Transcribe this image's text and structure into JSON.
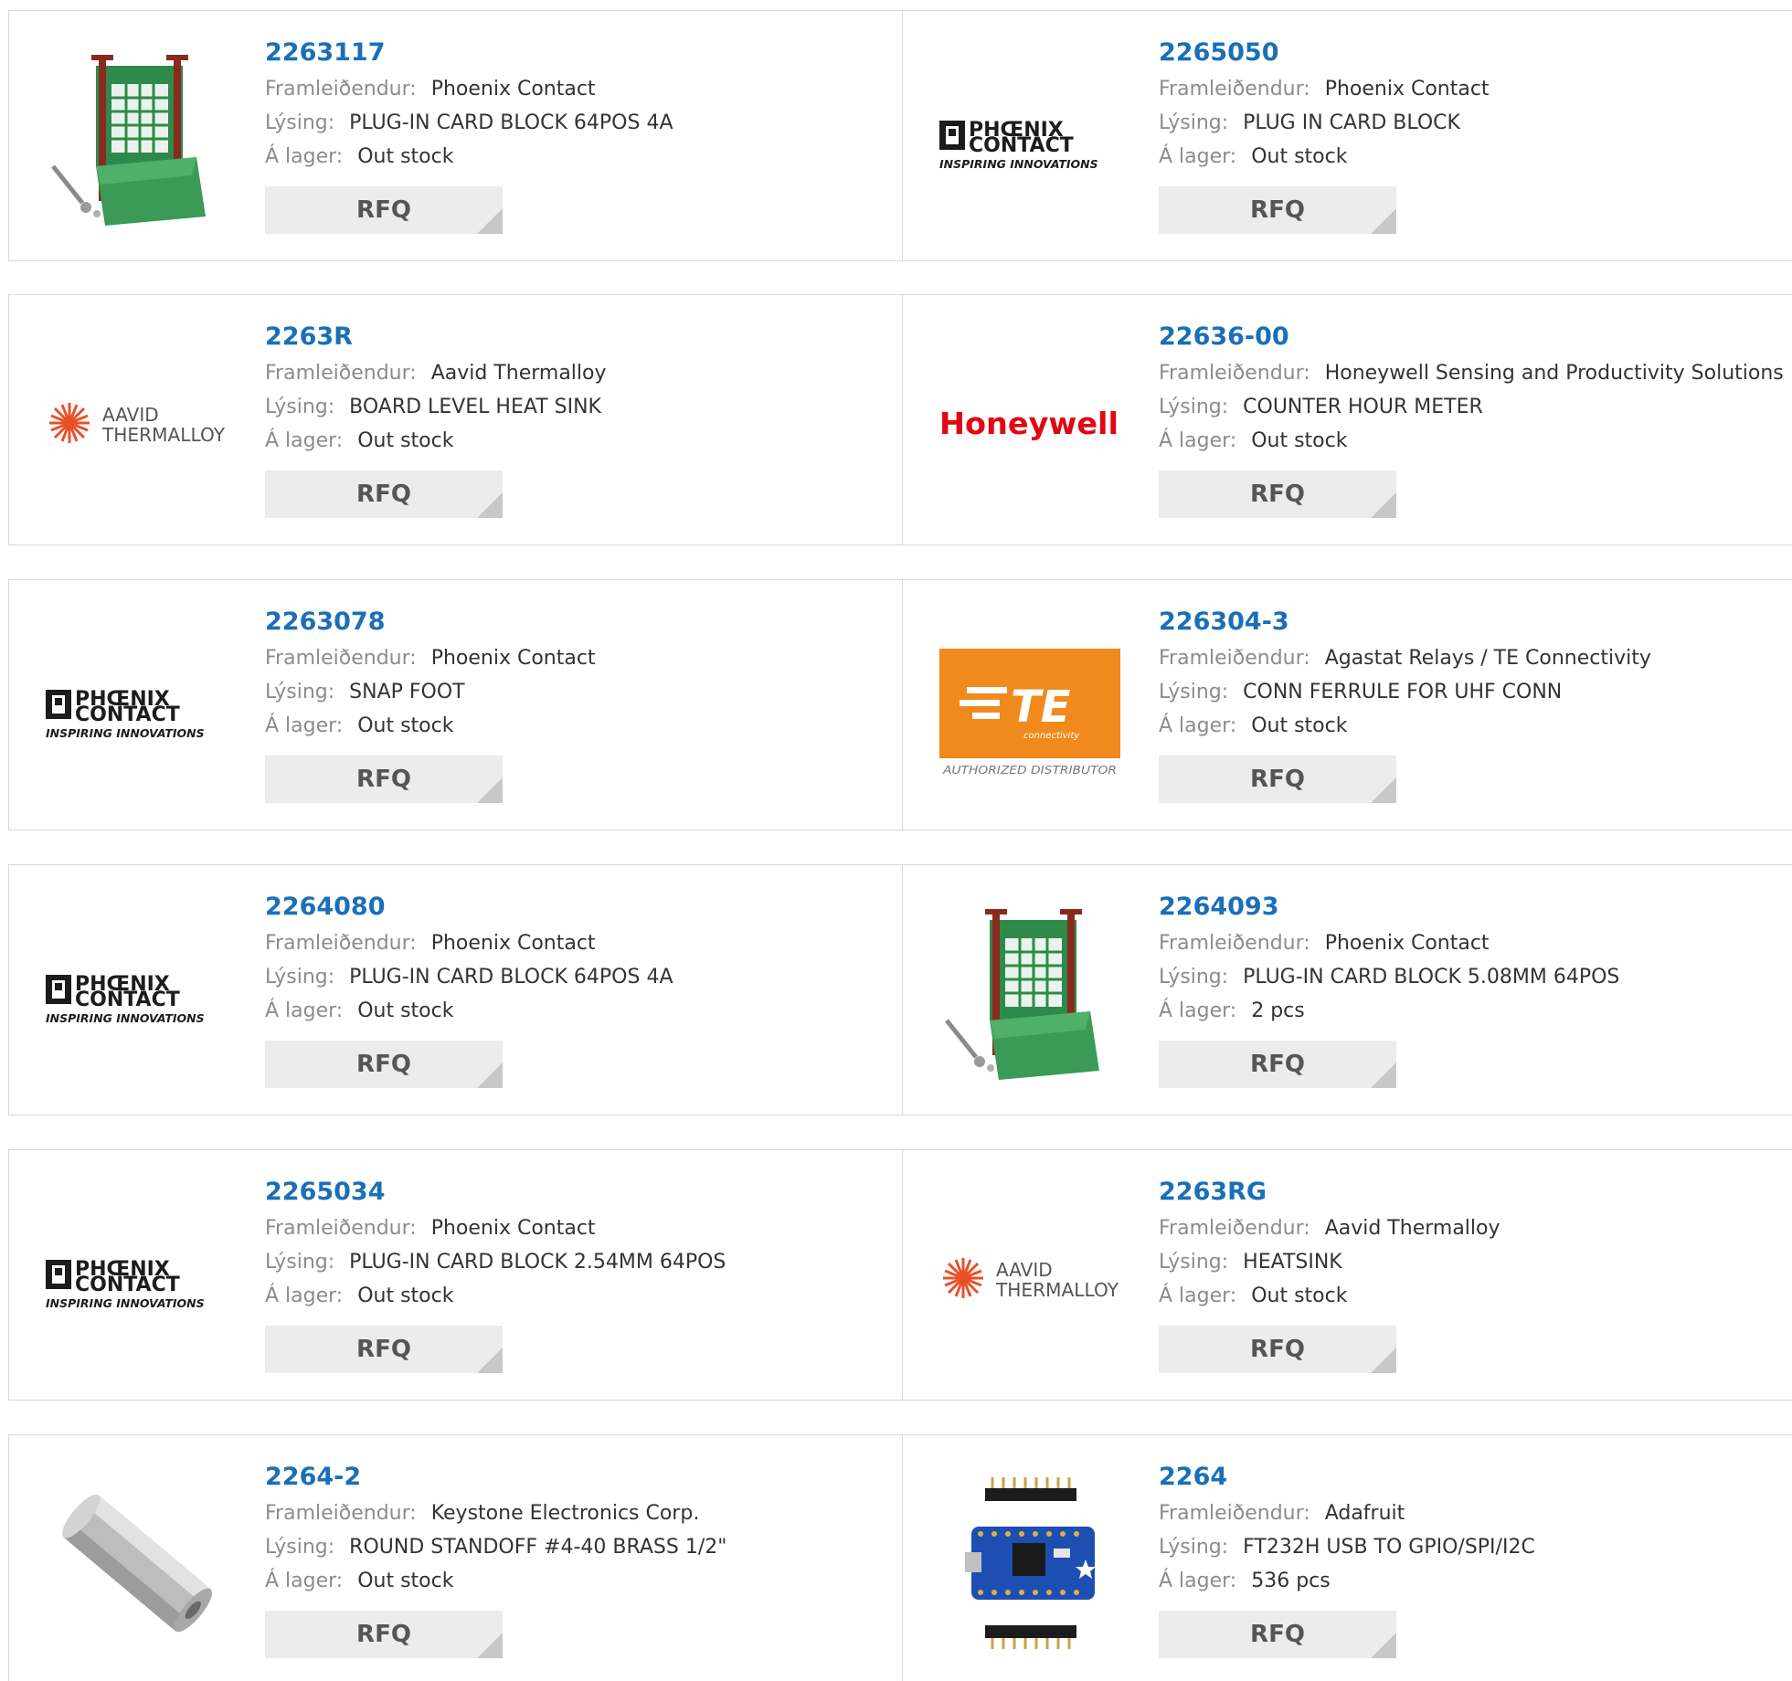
{
  "labels": {
    "manufacturer": "Framleiðendur:",
    "description": "Lýsing:",
    "stock": "Á lager:",
    "rfq": "RFQ"
  },
  "colors": {
    "part_link": "#1a6fb8",
    "label": "#8c8c8c",
    "button_bg": "#ececec"
  },
  "logos": {
    "phoenix_line1": "PHŒNIX",
    "phoenix_line2": "CONTACT",
    "phoenix_tag": "INSPIRING INNOVATIONS",
    "aavid_line1": "AAVID",
    "aavid_line2": "THERMALLOY",
    "honeywell": "Honeywell",
    "te_mark": "TE",
    "te_sub": "connectivity",
    "te_tag": "AUTHORIZED DISTRIBUTOR"
  },
  "products": [
    {
      "part": "2263117",
      "manufacturer": "Phoenix Contact",
      "description": "PLUG-IN CARD BLOCK 64POS 4A",
      "stock": "Out stock",
      "image": "card-block-photo"
    },
    {
      "part": "2265050",
      "manufacturer": "Phoenix Contact",
      "description": "PLUG IN CARD BLOCK",
      "stock": "Out stock",
      "image": "phoenix-contact-logo"
    },
    {
      "part": "2263R",
      "manufacturer": "Aavid Thermalloy",
      "description": "BOARD LEVEL HEAT SINK",
      "stock": "Out stock",
      "image": "aavid-thermalloy-logo"
    },
    {
      "part": "22636-00",
      "manufacturer": "Honeywell Sensing and Productivity Solutions",
      "description": "COUNTER HOUR METER",
      "stock": "Out stock",
      "image": "honeywell-logo"
    },
    {
      "part": "2263078",
      "manufacturer": "Phoenix Contact",
      "description": "SNAP FOOT",
      "stock": "Out stock",
      "image": "phoenix-contact-logo"
    },
    {
      "part": "226304-3",
      "manufacturer": "Agastat Relays / TE Connectivity",
      "description": "CONN FERRULE FOR UHF CONN",
      "stock": "Out stock",
      "image": "te-connectivity-logo"
    },
    {
      "part": "2264080",
      "manufacturer": "Phoenix Contact",
      "description": "PLUG-IN CARD BLOCK 64POS 4A",
      "stock": "Out stock",
      "image": "phoenix-contact-logo"
    },
    {
      "part": "2264093",
      "manufacturer": "Phoenix Contact",
      "description": "PLUG-IN CARD BLOCK 5.08MM 64POS",
      "stock": "2 pcs",
      "image": "card-block-photo"
    },
    {
      "part": "2265034",
      "manufacturer": "Phoenix Contact",
      "description": "PLUG-IN CARD BLOCK 2.54MM 64POS",
      "stock": "Out stock",
      "image": "phoenix-contact-logo"
    },
    {
      "part": "2263RG",
      "manufacturer": "Aavid Thermalloy",
      "description": "HEATSINK",
      "stock": "Out stock",
      "image": "aavid-thermalloy-logo"
    },
    {
      "part": "2264-2",
      "manufacturer": "Keystone Electronics Corp.",
      "description": "ROUND STANDOFF #4-40 BRASS 1/2\"",
      "stock": "Out stock",
      "image": "standoff-photo"
    },
    {
      "part": "2264",
      "manufacturer": "Adafruit",
      "description": "FT232H USB TO GPIO/SPI/I2C",
      "stock": "536 pcs",
      "image": "breakout-board-photo"
    }
  ]
}
